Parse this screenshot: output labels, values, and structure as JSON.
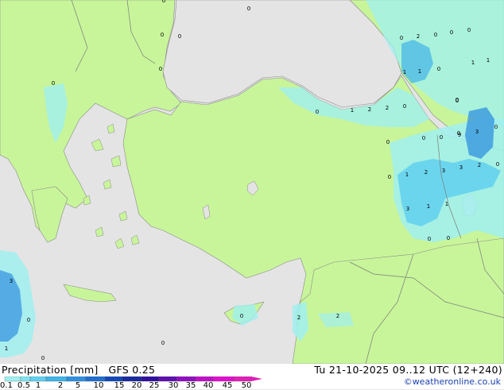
{
  "legend": {
    "title": "Precipitation [mm]",
    "model": "GFS 0.25",
    "timestamp": "Tu 21-10-2025 09..12 UTC (12+240)",
    "credit": "©weatheronline.co.uk",
    "scale_labels": [
      "0.1",
      "0.5",
      "1",
      "2",
      "5",
      "10",
      "15",
      "20",
      "25",
      "30",
      "35",
      "40",
      "45",
      "50"
    ],
    "scale_colors": [
      "#a0f0f0",
      "#80e4f0",
      "#60d0f0",
      "#40b4e8",
      "#3090e0",
      "#2070d0",
      "#1448b8",
      "#1a2aa0",
      "#3010a0",
      "#6010b0",
      "#9010c0",
      "#c010c8",
      "#e010d0",
      "#e020b8"
    ]
  },
  "map": {
    "colors": {
      "sea": "#e4e4e4",
      "land": "#c8f59a",
      "border": "#7a7a7a",
      "coast": "#8a8a8a"
    },
    "labels": [
      {
        "t": "0"
      },
      {
        "t": "0"
      },
      {
        "t": "0"
      },
      {
        "t": "0"
      },
      {
        "t": "0"
      },
      {
        "t": "0"
      },
      {
        "t": "0"
      },
      {
        "t": "2"
      },
      {
        "t": "0"
      },
      {
        "t": "0"
      },
      {
        "t": "1"
      },
      {
        "t": "0"
      },
      {
        "t": "1"
      },
      {
        "t": "1"
      },
      {
        "t": "0"
      },
      {
        "t": "1"
      },
      {
        "t": "0"
      },
      {
        "t": "0"
      },
      {
        "t": "1"
      },
      {
        "t": "2"
      },
      {
        "t": "2"
      },
      {
        "t": "0"
      },
      {
        "t": "0"
      },
      {
        "t": "0"
      },
      {
        "t": "0"
      },
      {
        "t": "9"
      },
      {
        "t": "0"
      },
      {
        "t": "3"
      },
      {
        "t": "0"
      },
      {
        "t": "0"
      },
      {
        "t": "1"
      },
      {
        "t": "2"
      },
      {
        "t": "3"
      },
      {
        "t": "3"
      },
      {
        "t": "2"
      },
      {
        "t": "0"
      },
      {
        "t": "3"
      },
      {
        "t": "1"
      },
      {
        "t": "1"
      },
      {
        "t": "0"
      },
      {
        "t": "0"
      },
      {
        "t": "2"
      },
      {
        "t": "3"
      },
      {
        "t": "0"
      },
      {
        "t": "1"
      },
      {
        "t": "0"
      },
      {
        "t": "0"
      },
      {
        "t": "2"
      },
      {
        "t": "0"
      },
      {
        "t": "0"
      }
    ]
  }
}
